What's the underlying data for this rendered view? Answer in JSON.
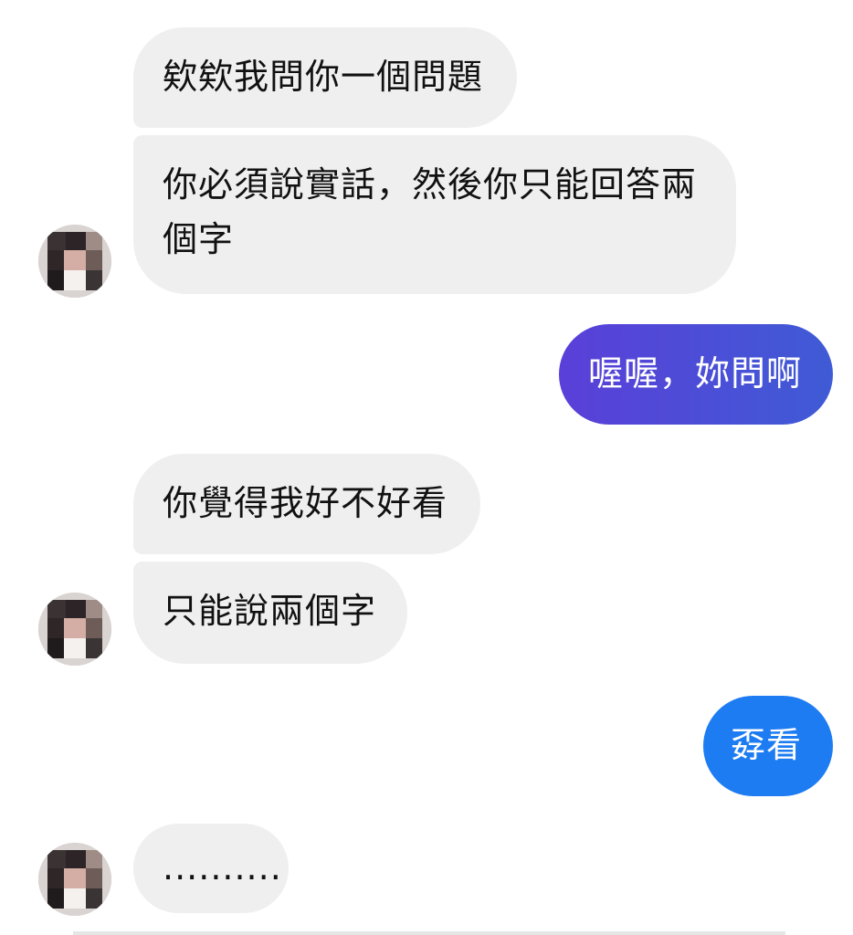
{
  "conversation": {
    "messages": [
      {
        "sender": "other",
        "text": "欸欸我問你一個問題"
      },
      {
        "sender": "other",
        "text_line1": "你必須說實話，然後你只能回答兩",
        "text_line2": "個字"
      },
      {
        "sender": "me",
        "text": "喔喔，妳問啊"
      },
      {
        "sender": "other",
        "text": "你覺得我好不好看"
      },
      {
        "sender": "other",
        "text": "只能說兩個字"
      },
      {
        "sender": "me",
        "text": "孬看"
      },
      {
        "sender": "other",
        "text": ".........."
      }
    ]
  },
  "colors": {
    "incoming_bubble": "#efefef",
    "outgoing_gradient_start": "#5a3fd8",
    "outgoing_gradient_end": "#3f5bd6",
    "outgoing_blue": "#1e7cf2",
    "text_dark": "#111111",
    "text_light": "#ffffff"
  },
  "icons": {
    "avatar": "avatar-icon"
  }
}
